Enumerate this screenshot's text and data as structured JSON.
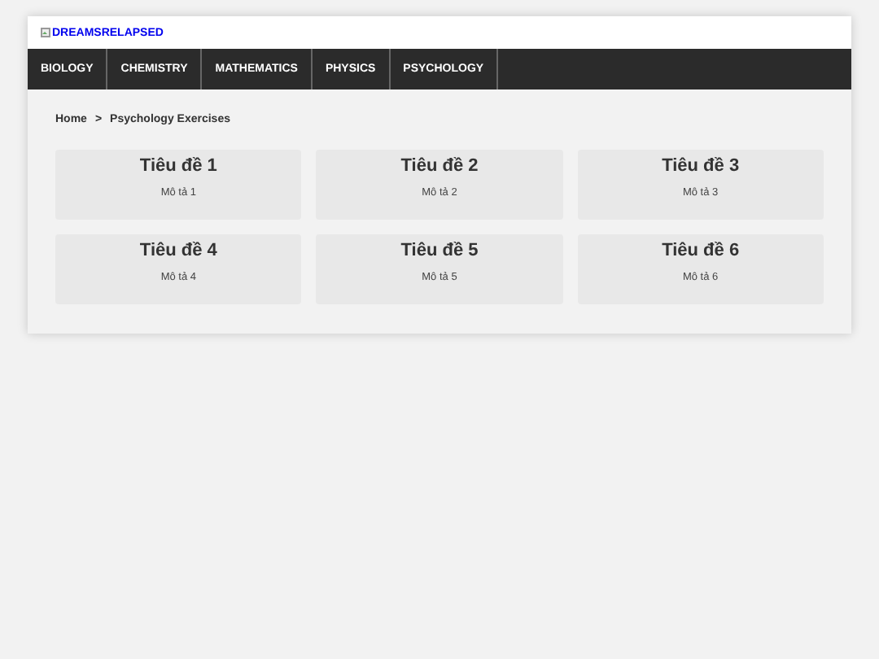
{
  "logo": {
    "alt": "DREAMSRELAPSED"
  },
  "nav": [
    {
      "label": "BIOLOGY"
    },
    {
      "label": "CHEMISTRY"
    },
    {
      "label": "MATHEMATICS"
    },
    {
      "label": "PHYSICS"
    },
    {
      "label": "PSYCHOLOGY"
    }
  ],
  "breadcrumb": {
    "home": "Home",
    "separator": ">",
    "current": "Psychology Exercises"
  },
  "cards": [
    {
      "title": "Tiêu đề 1",
      "description": "Mô tả 1"
    },
    {
      "title": "Tiêu đề 2",
      "description": "Mô tả 2"
    },
    {
      "title": "Tiêu đề 3",
      "description": "Mô tả 3"
    },
    {
      "title": "Tiêu đề 4",
      "description": "Mô tả 4"
    },
    {
      "title": "Tiêu đề 5",
      "description": "Mô tả 5"
    },
    {
      "title": "Tiêu đề 6",
      "description": "Mô tả 6"
    }
  ]
}
